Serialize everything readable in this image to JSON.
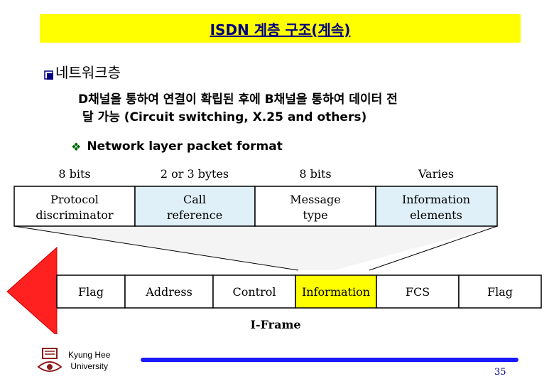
{
  "title": "ISDN 계층 구조(계속)",
  "bullet1": {
    "marker_icon": "q-bullet-icon",
    "text": "네트워크층"
  },
  "description": {
    "line1": "D채널을 통하여 연결이 확립된 후에 B채널을 통하여 데이터 전",
    "line2": "달 가능 (Circuit switching, X.25 and others)"
  },
  "bullet2": {
    "marker_icon": "diamond-bullet-icon",
    "text": "Network layer packet format"
  },
  "packet": {
    "size_labels": [
      "8 bits",
      "2 or 3 bytes",
      "8 bits",
      "Varies"
    ],
    "fields": [
      {
        "line1": "Protocol",
        "line2": "discriminator",
        "color": "#ffffff"
      },
      {
        "line1": "Call",
        "line2": "reference",
        "color": "#e0f0f8"
      },
      {
        "line1": "Message",
        "line2": "type",
        "color": "#ffffff"
      },
      {
        "line1": "Information",
        "line2": "elements",
        "color": "#e0f0f8"
      }
    ]
  },
  "frame": {
    "fields": [
      {
        "label": "Flag",
        "color": "#ffffff"
      },
      {
        "label": "Address",
        "color": "#ffffff"
      },
      {
        "label": "Control",
        "color": "#ffffff"
      },
      {
        "label": "Information",
        "color": "#ffff00"
      },
      {
        "label": "FCS",
        "color": "#ffffff"
      },
      {
        "label": "Flag",
        "color": "#ffffff"
      }
    ],
    "caption": "I-Frame"
  },
  "colors": {
    "title_bg": "#ffff00",
    "title_text": "#000080",
    "arrow": "#ff2020",
    "footer_line": "#1a1aff"
  },
  "footer": {
    "org_line1": "Kyung Hee",
    "org_line2": "University",
    "page_number": "35"
  }
}
